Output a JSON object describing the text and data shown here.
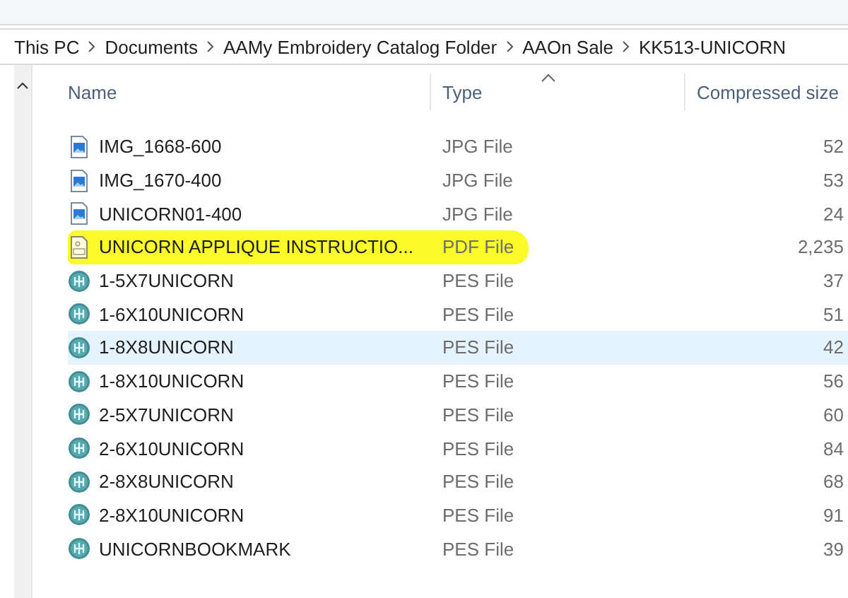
{
  "breadcrumb": [
    "This PC",
    "Documents",
    "AAMy Embroidery Catalog Folder",
    "AAOn Sale",
    "KK513-UNICORN"
  ],
  "columns": [
    "Name",
    "Type",
    "Compressed size"
  ],
  "files": [
    {
      "kind": "image",
      "name": "IMG_1668-600",
      "type": "JPG File",
      "size": "52",
      "highlighted": false,
      "hovered": false
    },
    {
      "kind": "image",
      "name": "IMG_1670-400",
      "type": "JPG File",
      "size": "53",
      "highlighted": false,
      "hovered": false
    },
    {
      "kind": "image",
      "name": "UNICORN01-400",
      "type": "JPG File",
      "size": "24",
      "highlighted": false,
      "hovered": false
    },
    {
      "kind": "pdf",
      "name": "UNICORN APPLIQUE INSTRUCTIO...",
      "type": "PDF File",
      "size": "2,235",
      "highlighted": true,
      "hovered": false
    },
    {
      "kind": "pes",
      "name": "1-5X7UNICORN",
      "type": "PES File",
      "size": "37",
      "highlighted": false,
      "hovered": false
    },
    {
      "kind": "pes",
      "name": "1-6X10UNICORN",
      "type": "PES File",
      "size": "51",
      "highlighted": false,
      "hovered": false
    },
    {
      "kind": "pes",
      "name": "1-8X8UNICORN",
      "type": "PES File",
      "size": "42",
      "highlighted": false,
      "hovered": true
    },
    {
      "kind": "pes",
      "name": "1-8X10UNICORN",
      "type": "PES File",
      "size": "56",
      "highlighted": false,
      "hovered": false
    },
    {
      "kind": "pes",
      "name": "2-5X7UNICORN",
      "type": "PES File",
      "size": "60",
      "highlighted": false,
      "hovered": false
    },
    {
      "kind": "pes",
      "name": "2-6X10UNICORN",
      "type": "PES File",
      "size": "84",
      "highlighted": false,
      "hovered": false
    },
    {
      "kind": "pes",
      "name": "2-8X8UNICORN",
      "type": "PES File",
      "size": "68",
      "highlighted": false,
      "hovered": false
    },
    {
      "kind": "pes",
      "name": "2-8X10UNICORN",
      "type": "PES File",
      "size": "91",
      "highlighted": false,
      "hovered": false
    },
    {
      "kind": "pes",
      "name": "UNICORNBOOKMARK",
      "type": "PES File",
      "size": "39",
      "highlighted": false,
      "hovered": false
    }
  ]
}
